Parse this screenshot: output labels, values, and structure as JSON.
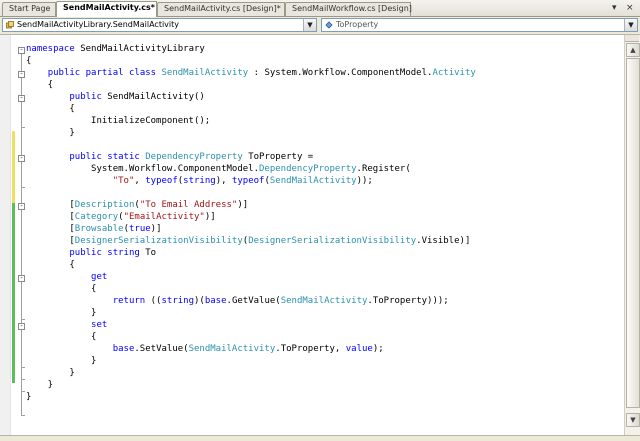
{
  "tabs": [
    {
      "label": "Start Page",
      "active": false
    },
    {
      "label": "SendMailActivity.cs*",
      "active": true
    },
    {
      "label": "SendMailActivity.cs [Design]*",
      "active": false
    },
    {
      "label": "SendMailWorkflow.cs [Design]",
      "active": false
    }
  ],
  "tab_controls": {
    "dropdown": "▾",
    "close": "×"
  },
  "navbar": {
    "type_dropdown": "SendMailActivityLibrary.SendMailActivity",
    "member_dropdown": "ToProperty"
  },
  "colors": {
    "keyword": "#0000ff",
    "type": "#2b91af",
    "string": "#a31515"
  },
  "code_lines": [
    [
      {
        "t": "namespace",
        "c": "kw"
      },
      {
        "t": " SendMailActivityLibrary"
      }
    ],
    [
      {
        "t": "{"
      }
    ],
    [
      {
        "t": "    "
      },
      {
        "t": "public",
        "c": "kw"
      },
      {
        "t": " "
      },
      {
        "t": "partial",
        "c": "kw"
      },
      {
        "t": " "
      },
      {
        "t": "class",
        "c": "kw"
      },
      {
        "t": " "
      },
      {
        "t": "SendMailActivity",
        "c": "ty"
      },
      {
        "t": " : System.Workflow.ComponentModel."
      },
      {
        "t": "Activity",
        "c": "ty"
      }
    ],
    [
      {
        "t": "    {"
      }
    ],
    [
      {
        "t": "        "
      },
      {
        "t": "public",
        "c": "kw"
      },
      {
        "t": " SendMailActivity()"
      }
    ],
    [
      {
        "t": "        {"
      }
    ],
    [
      {
        "t": "            InitializeComponent();"
      }
    ],
    [
      {
        "t": "        }"
      }
    ],
    [
      {
        "t": ""
      }
    ],
    [
      {
        "t": "        "
      },
      {
        "t": "public",
        "c": "kw"
      },
      {
        "t": " "
      },
      {
        "t": "static",
        "c": "kw"
      },
      {
        "t": " "
      },
      {
        "t": "DependencyProperty",
        "c": "ty"
      },
      {
        "t": " ToProperty ="
      }
    ],
    [
      {
        "t": "            System.Workflow.ComponentModel."
      },
      {
        "t": "DependencyProperty",
        "c": "ty"
      },
      {
        "t": ".Register("
      }
    ],
    [
      {
        "t": "                "
      },
      {
        "t": "\"To\"",
        "c": "st"
      },
      {
        "t": ", "
      },
      {
        "t": "typeof",
        "c": "kw"
      },
      {
        "t": "("
      },
      {
        "t": "string",
        "c": "kw"
      },
      {
        "t": "), "
      },
      {
        "t": "typeof",
        "c": "kw"
      },
      {
        "t": "("
      },
      {
        "t": "SendMailActivity",
        "c": "ty"
      },
      {
        "t": "));"
      }
    ],
    [
      {
        "t": ""
      }
    ],
    [
      {
        "t": "        ["
      },
      {
        "t": "Description",
        "c": "ty"
      },
      {
        "t": "("
      },
      {
        "t": "\"To Email Address\"",
        "c": "st"
      },
      {
        "t": ")]"
      }
    ],
    [
      {
        "t": "        ["
      },
      {
        "t": "Category",
        "c": "ty"
      },
      {
        "t": "("
      },
      {
        "t": "\"EmailActivity\"",
        "c": "st"
      },
      {
        "t": ")]"
      }
    ],
    [
      {
        "t": "        ["
      },
      {
        "t": "Browsable",
        "c": "ty"
      },
      {
        "t": "("
      },
      {
        "t": "true",
        "c": "kw"
      },
      {
        "t": ")]"
      }
    ],
    [
      {
        "t": "        ["
      },
      {
        "t": "DesignerSerializationVisibility",
        "c": "ty"
      },
      {
        "t": "("
      },
      {
        "t": "DesignerSerializationVisibility",
        "c": "ty"
      },
      {
        "t": ".Visible)]"
      }
    ],
    [
      {
        "t": "        "
      },
      {
        "t": "public",
        "c": "kw"
      },
      {
        "t": " "
      },
      {
        "t": "string",
        "c": "kw"
      },
      {
        "t": " To"
      }
    ],
    [
      {
        "t": "        {"
      }
    ],
    [
      {
        "t": "            "
      },
      {
        "t": "get",
        "c": "kw"
      }
    ],
    [
      {
        "t": "            {"
      }
    ],
    [
      {
        "t": "                "
      },
      {
        "t": "return",
        "c": "kw"
      },
      {
        "t": " (("
      },
      {
        "t": "string",
        "c": "kw"
      },
      {
        "t": ")("
      },
      {
        "t": "base",
        "c": "kw"
      },
      {
        "t": ".GetValue("
      },
      {
        "t": "SendMailActivity",
        "c": "ty"
      },
      {
        "t": ".ToProperty)));"
      }
    ],
    [
      {
        "t": "            }"
      }
    ],
    [
      {
        "t": "            "
      },
      {
        "t": "set",
        "c": "kw"
      }
    ],
    [
      {
        "t": "            {"
      }
    ],
    [
      {
        "t": "                "
      },
      {
        "t": "base",
        "c": "kw"
      },
      {
        "t": ".SetValue("
      },
      {
        "t": "SendMailActivity",
        "c": "ty"
      },
      {
        "t": ".ToProperty, "
      },
      {
        "t": "value",
        "c": "kw"
      },
      {
        "t": ");"
      }
    ],
    [
      {
        "t": "            }"
      }
    ],
    [
      {
        "t": "        }"
      }
    ],
    [
      {
        "t": "    }"
      }
    ],
    [
      {
        "t": "}"
      }
    ]
  ],
  "scrollbar": {
    "up_arrow": "▲",
    "down_arrow": "▼"
  }
}
